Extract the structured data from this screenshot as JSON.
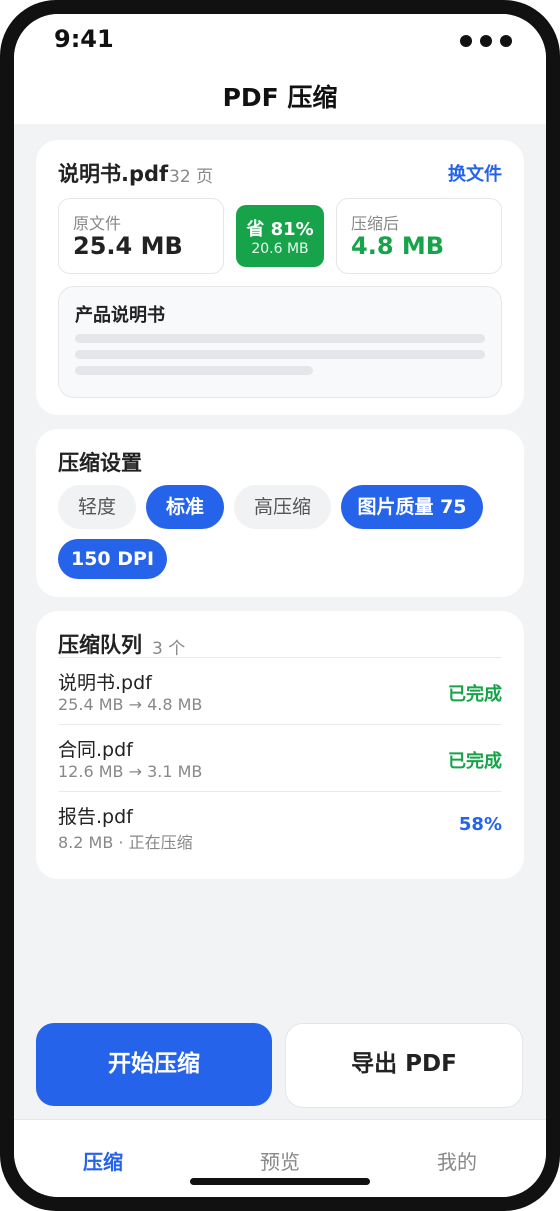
{
  "status": {
    "time": "9:41"
  },
  "header": {
    "title": "PDF 压缩"
  },
  "file": {
    "name": "说明书.pdf",
    "pages": "32 页",
    "change_label": "换文件",
    "original": {
      "label": "原文件",
      "size": "25.4 MB"
    },
    "savings": {
      "percent": "省 81%",
      "saved": "20.6 MB"
    },
    "compressed": {
      "label": "压缩后",
      "size": "4.8 MB"
    },
    "preview_title": "产品说明书"
  },
  "settings": {
    "title": "压缩设置",
    "levels": [
      "轻度",
      "标准",
      "高压缩"
    ],
    "selected_level": "标准",
    "image_quality": "图片质量 75",
    "dpi": "150 DPI"
  },
  "queue": {
    "title": "压缩队列",
    "count": "3 个",
    "items": [
      {
        "name": "说明书.pdf",
        "detail": "25.4 MB → 4.8 MB",
        "status": "已完成"
      },
      {
        "name": "合同.pdf",
        "detail": "12.6 MB → 3.1 MB",
        "status": "已完成"
      },
      {
        "name": "报告.pdf",
        "detail": "8.2 MB · 正在压缩",
        "status": "58%"
      }
    ]
  },
  "actions": {
    "start": "开始压缩",
    "export": "导出 PDF"
  },
  "tabs": [
    {
      "label": "压缩",
      "active": true
    },
    {
      "label": "预览",
      "active": false
    },
    {
      "label": "我的",
      "active": false
    }
  ],
  "colors": {
    "accent": "#2563eb",
    "success": "#16a34a"
  }
}
